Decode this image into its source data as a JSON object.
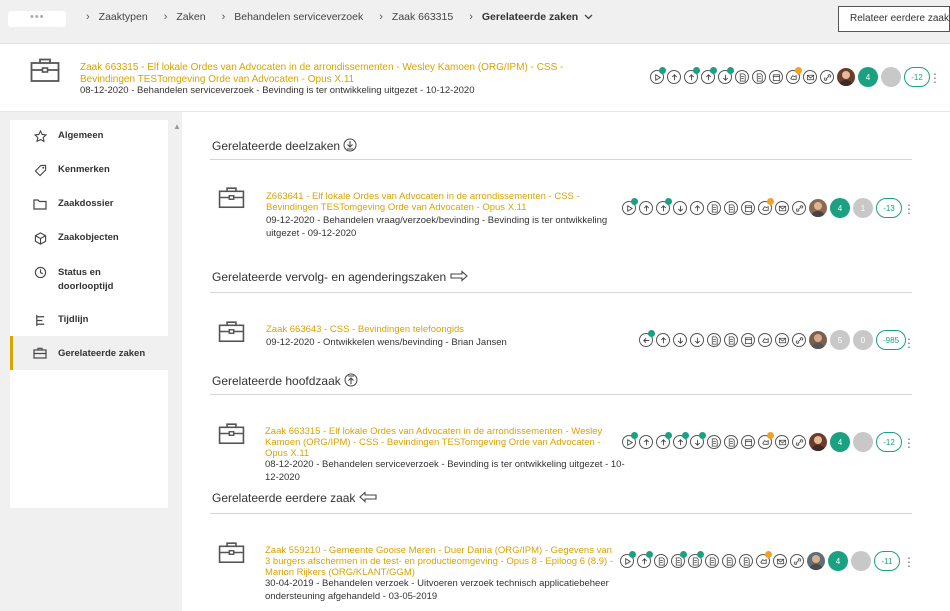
{
  "topbar": {
    "logo": "•••",
    "breadcrumbs": [
      "Zaaktypen",
      "Zaken",
      "Behandelen serviceverzoek",
      "Zaak 663315"
    ],
    "current": "Gerelateerde zaken",
    "relate_button": "Relateer eerdere zaak"
  },
  "case": {
    "title": "Zaak 663315 - Elf lokale Ordes van Advocaten in de arrondissementen - Wesley Kamoen (ORG/IPM) - CSS - Bevindingen TESTomgeving Orde van Advocaten - Opus X.11",
    "meta": "08-12-2020 - Behandelen serviceverzoek - Bevinding is ter ontwikkeling uitgezet - 10-12-2020",
    "count": "4",
    "pill": "-12"
  },
  "nav": [
    {
      "label": "Algemeen",
      "icon": "star-icon"
    },
    {
      "label": "Kenmerken",
      "icon": "tag-icon"
    },
    {
      "label": "Zaakdossier",
      "icon": "folder-icon"
    },
    {
      "label": "Zaakobjecten",
      "icon": "box-icon"
    },
    {
      "label": "Status en doorlooptijd",
      "icon": "clock-icon"
    },
    {
      "label": "Tijdlijn",
      "icon": "timeline-icon"
    },
    {
      "label": "Gerelateerde zaken",
      "icon": "briefcase-icon"
    }
  ],
  "sections": [
    {
      "title": "Gerelateerde deelzaken",
      "icon": "deelzaak-icon"
    },
    {
      "title": "Gerelateerde vervolg- en agenderingszaken",
      "icon": "vervolg-icon"
    },
    {
      "title": "Gerelateerde hoofdzaak",
      "icon": "hoofdzaak-icon"
    },
    {
      "title": "Gerelateerde eerdere zaak",
      "icon": "eerdere-icon"
    }
  ],
  "rows": [
    {
      "title": "Z663641 - Elf lokale Ordes van Advocaten in de arrondissementen - CSS - Bevindingen TESTomgeving Orde van Advocaten - Opus X.11",
      "meta": "09-12-2020 - Behandelen vraag/verzoek/bevinding - Bevinding is ter ontwikkeling uitgezet - 09-12-2020",
      "count_a": "4",
      "count_b": "1",
      "pill": "-13"
    },
    {
      "title": "Zaak 663643 - CSS - Bevindingen telefoongids",
      "meta": "09-12-2020 - Ontwikkelen wens/bevinding - Brian Jansen",
      "count_a": "5",
      "count_b": "0",
      "pill": "-985"
    },
    {
      "title": "Zaak 663315 - Elf lokale Ordes van Advocaten in de arrondissementen - Wesley Kamoen (ORG/IPM) - CSS - Bevindingen TESTomgeving Orde van Advocaten - Opus X.11",
      "meta": "08-12-2020 - Behandelen serviceverzoek - Bevinding is ter ontwikkeling uitgezet - 10-12-2020",
      "count_a": "4",
      "count_b": "",
      "pill": "-12"
    },
    {
      "title": "Zaak 559210 - Gemeente Gooise Meren - Duer Dania (ORG/IPM) - Gegevens van 3 burgers afschermen in de test- en productieomgeving - Opus 8 - Epiloog 6 (8.9) - Marion Rijkers (ORG/KLANT/GGM)",
      "meta": "30-04-2019 - Behandelen verzoek - Uitvoeren verzoek technisch applicatiebeheer ondersteuning afgehandeld - 03-05-2019",
      "count_a": "4",
      "count_b": "",
      "pill": "-11"
    }
  ],
  "colors": {
    "accent": "#d9a300",
    "teal": "#1aa182",
    "orange": "#f5a022",
    "grey": "#c8c8c8"
  }
}
